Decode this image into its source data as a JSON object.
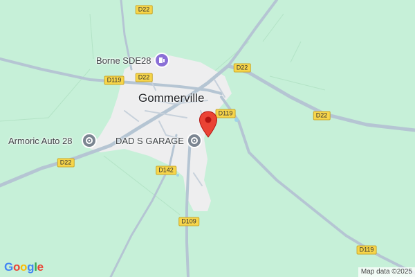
{
  "map": {
    "colors": {
      "land": "#c6f0d8",
      "urban": "#eeeeef",
      "road": "#b5c5d3",
      "road_badge": "#f7d54a",
      "marker": "#ea4335",
      "poi_gray": "#7b8591",
      "poi_purple": "#8a6fd6"
    },
    "town": "Gommerville",
    "pois": {
      "charging": "Borne SDE28",
      "garage_east": "DAD S GARAGE",
      "garage_west": "Armoric Auto 28"
    },
    "roads": {
      "d22_north": "D22",
      "d22_center": "D22",
      "d22_east": "D22",
      "d22_west": "D22",
      "d119_west": "D119",
      "d119_center": "D119",
      "d119_south": "D119",
      "d142": "D142",
      "d109": "D109"
    },
    "marker_icon": "location-pin-icon",
    "charging_icon": "ev-charging-icon",
    "garage_icon": "garage-icon"
  },
  "branding": {
    "logo": "Google",
    "attribution": "Map data ©2025"
  }
}
